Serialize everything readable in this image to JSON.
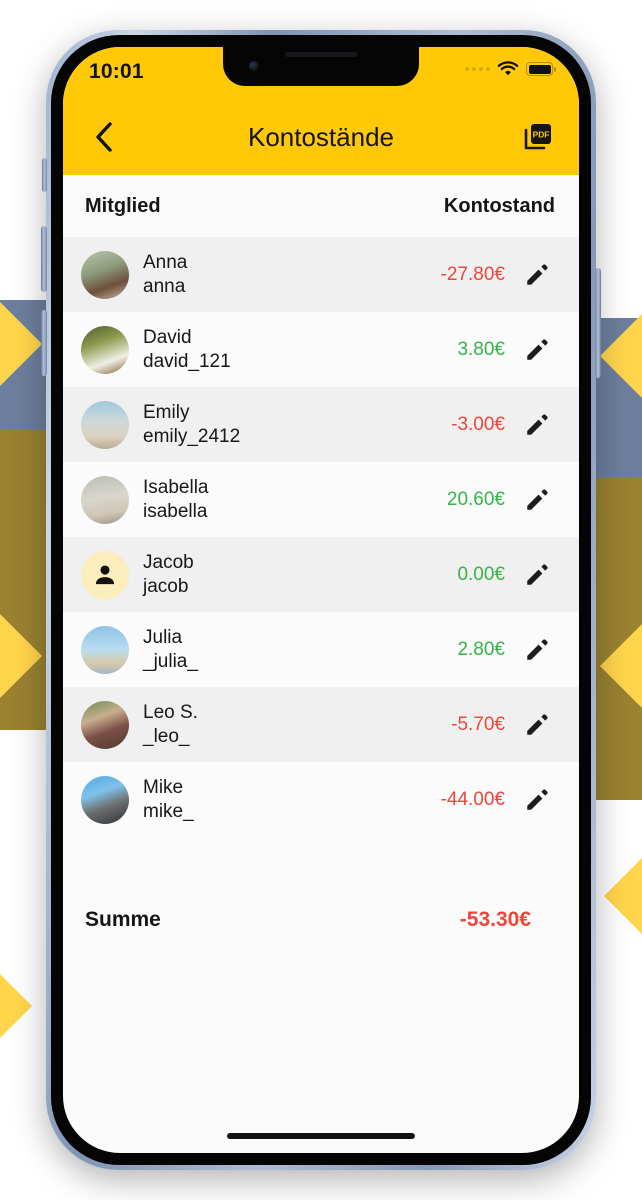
{
  "theme": {
    "brand_yellow": "#FFC907",
    "negative_color": "#F0453A",
    "positive_color": "#35B44A",
    "row_alt_bg": "#F0F0F0",
    "row_bg": "#FBFBFB"
  },
  "status_bar": {
    "time": "10:01",
    "cellular_icon": "signal-dots-icon",
    "wifi_icon": "wifi-icon",
    "battery_icon": "battery-icon"
  },
  "nav": {
    "back_icon": "chevron-left-icon",
    "title": "Kontostände",
    "pdf_icon": "pdf-export-icon"
  },
  "table": {
    "columns": {
      "member": "Mitglied",
      "balance": "Kontostand"
    },
    "edit_icon": "pencil-edit-icon",
    "rows": [
      {
        "name": "Anna",
        "username": "anna",
        "amount": "-27.80€",
        "sign": "neg",
        "avatar": "photo",
        "avatar_desc": "woman-in-field-photo"
      },
      {
        "name": "David",
        "username": "david_121",
        "amount": "3.80€",
        "sign": "pos",
        "avatar": "photo",
        "avatar_desc": "person-on-boat-photo"
      },
      {
        "name": "Emily",
        "username": "emily_2412",
        "amount": "-3.00€",
        "sign": "neg",
        "avatar": "photo",
        "avatar_desc": "woman-on-beach-photo"
      },
      {
        "name": "Isabella",
        "username": "isabella",
        "amount": "20.60€",
        "sign": "pos",
        "avatar": "photo",
        "avatar_desc": "woman-white-dress-photo"
      },
      {
        "name": "Jacob",
        "username": "jacob",
        "amount": "0.00€",
        "sign": "pos",
        "avatar": "placeholder",
        "avatar_desc": "person-placeholder-icon"
      },
      {
        "name": "Julia",
        "username": "_julia_",
        "amount": "2.80€",
        "sign": "pos",
        "avatar": "photo",
        "avatar_desc": "woman-jumping-beach-photo"
      },
      {
        "name": "Leo S.",
        "username": "_leo_",
        "amount": "-5.70€",
        "sign": "neg",
        "avatar": "photo",
        "avatar_desc": "man-sunglasses-photo"
      },
      {
        "name": "Mike",
        "username": "mike_",
        "amount": "-44.00€",
        "sign": "neg",
        "avatar": "photo",
        "avatar_desc": "man-with-camera-photo"
      }
    ]
  },
  "summary": {
    "label": "Summe",
    "value": "-53.30€"
  }
}
